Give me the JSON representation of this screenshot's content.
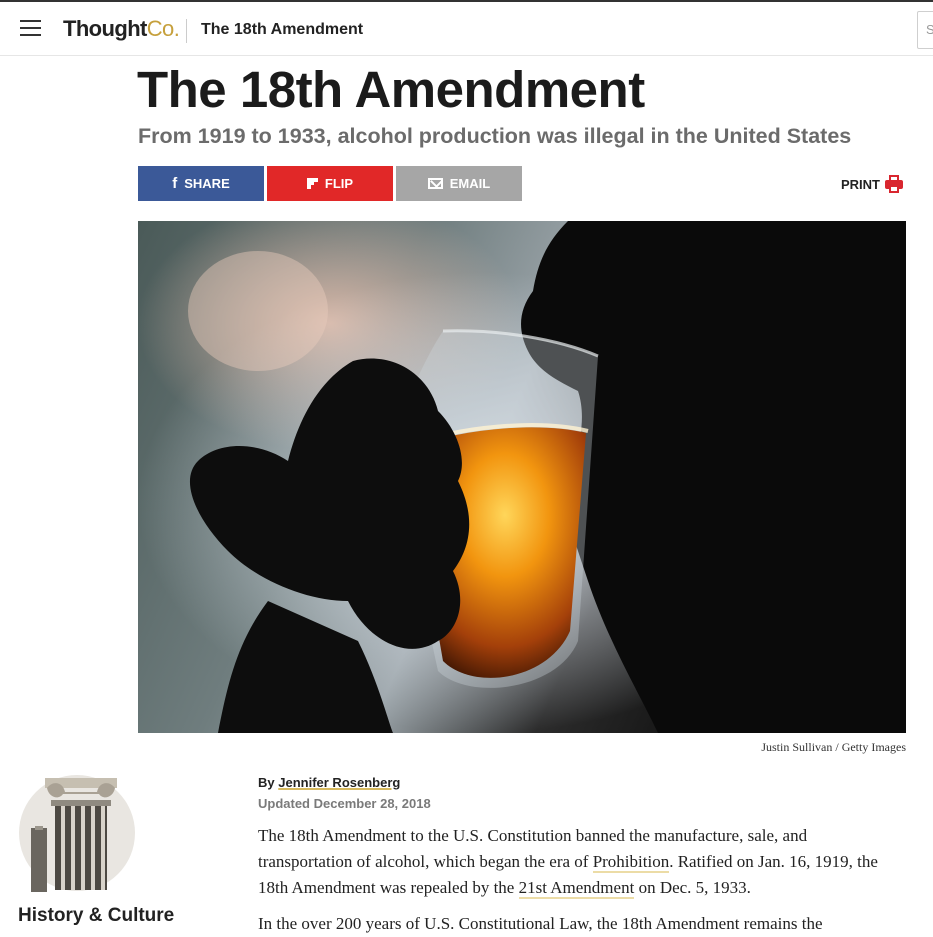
{
  "header": {
    "logo_main": "Thought",
    "logo_accent": "Co.",
    "nav_title": "The 18th Amendment",
    "search_placeholder": "S"
  },
  "article": {
    "title": "The 18th Amendment",
    "subtitle": "From 1919 to 1933, alcohol production was illegal in the United States"
  },
  "share": {
    "share_label": "SHARE",
    "flip_label": "FLIP",
    "email_label": "EMAIL",
    "print_label": "PRINT"
  },
  "image": {
    "credit": "Justin Sullivan / Getty Images"
  },
  "category": {
    "label": "History & Culture"
  },
  "byline": {
    "prefix": "By",
    "author": "Jennifer Rosenberg",
    "updated": "Updated December 28, 2018"
  },
  "body": {
    "p1_a": "The 18th Amendment to the U.S. Constitution banned the manufacture, sale, and transportation of alcohol, which began the era of ",
    "p1_link1": "Prohibition",
    "p1_b": ". Ratified on Jan. 16, 1919, the 18th Amendment was repealed by the ",
    "p1_link2": "21st Amendment",
    "p1_c": " on Dec. 5, 1933.",
    "p2": "In the over 200 years of U.S. Constitutional Law, the 18th Amendment remains the"
  },
  "colors": {
    "share_facebook": "#3b5998",
    "share_flip": "#e12828",
    "share_email": "#a6a6a6",
    "print_accent": "#d9262f",
    "logo_accent": "#c6a03c",
    "link_underline": "#ecdca6"
  },
  "icons": {
    "menu": "hamburger-icon",
    "facebook": "facebook-icon",
    "flipboard": "flipboard-icon",
    "email": "mail-icon",
    "print": "printer-icon",
    "category": "column-icon"
  }
}
